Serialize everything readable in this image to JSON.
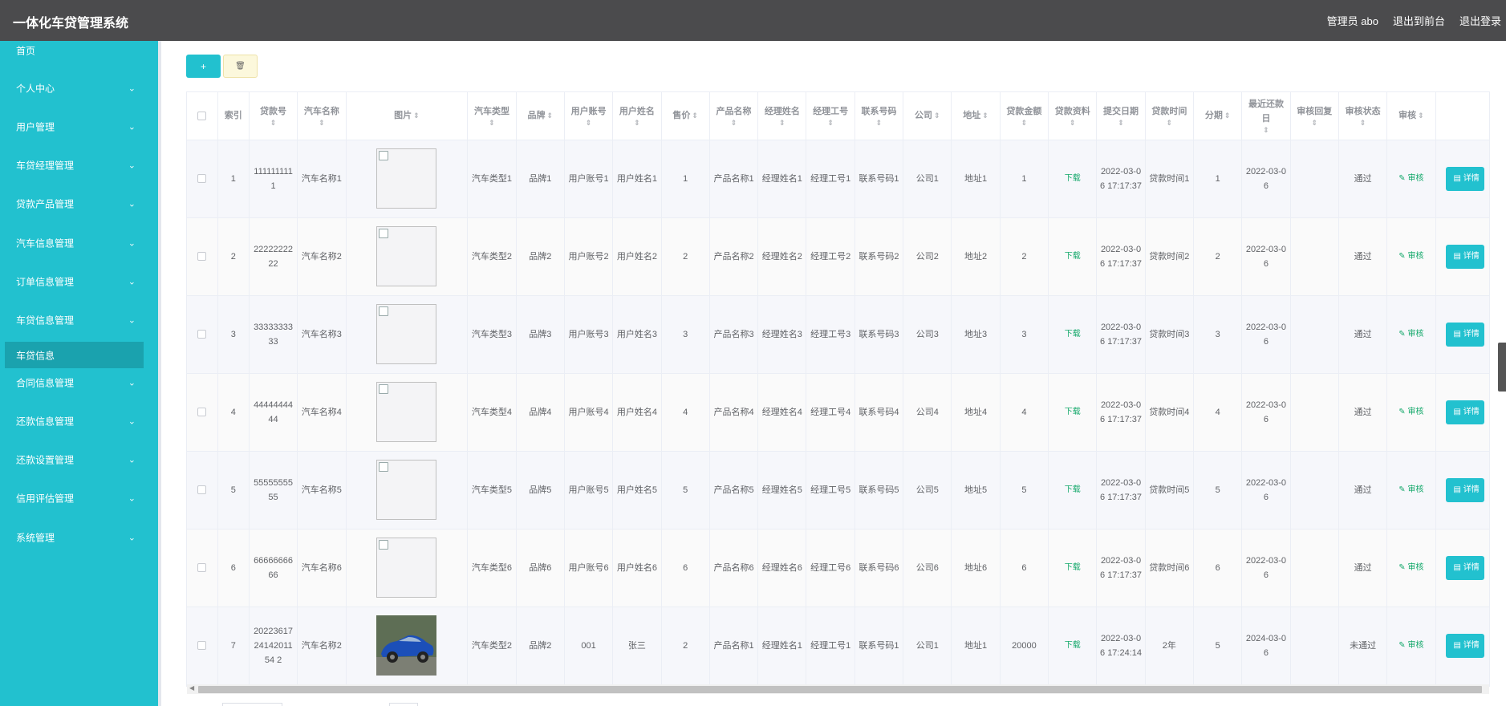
{
  "app": {
    "title": "一体化车贷管理系统",
    "admin_label": "管理员 abo",
    "to_frontend": "退出到前台",
    "logout": "退出登录"
  },
  "sidebar": {
    "items": [
      {
        "label": "首页",
        "chevron": false
      },
      {
        "label": "个人中心",
        "chevron": true
      },
      {
        "label": "用户管理",
        "chevron": true
      },
      {
        "label": "车贷经理管理",
        "chevron": true
      },
      {
        "label": "贷款产品管理",
        "chevron": true
      },
      {
        "label": "汽车信息管理",
        "chevron": true
      },
      {
        "label": "订单信息管理",
        "chevron": true
      },
      {
        "label": "车贷信息管理",
        "chevron": true
      },
      {
        "label": "合同信息管理",
        "chevron": true
      },
      {
        "label": "还款信息管理",
        "chevron": true
      },
      {
        "label": "还款设置管理",
        "chevron": true
      },
      {
        "label": "信用评估管理",
        "chevron": true
      },
      {
        "label": "系统管理",
        "chevron": true
      }
    ],
    "active_sub": "车贷信息"
  },
  "toolbar": {
    "add_icon": "plus-icon",
    "add_label": "+",
    "delete_icon": "trash-icon",
    "delete_label": "🗑"
  },
  "table": {
    "columns": [
      "索引",
      "贷款号",
      "汽车名称",
      "图片",
      "汽车类型",
      "品牌",
      "用户账号",
      "用户姓名",
      "售价",
      "产品名称",
      "经理姓名",
      "经理工号",
      "联系号码",
      "公司",
      "地址",
      "贷款金额",
      "贷款资料",
      "提交日期",
      "贷款时间",
      "分期",
      "最近还款日",
      "审核回复",
      "审核状态",
      "审核",
      ""
    ],
    "download_label": "下载",
    "review_label": "审核",
    "detail_label": "详情",
    "rows": [
      {
        "index": "1",
        "loan_no": "1111111111",
        "car_name": "汽车名称1",
        "image": "broken",
        "car_type": "汽车类型1",
        "brand": "品牌1",
        "user_account": "用户账号1",
        "user_name": "用户姓名1",
        "price": "1",
        "product": "产品名称1",
        "manager_name": "经理姓名1",
        "manager_id": "经理工号1",
        "phone": "联系号码1",
        "company": "公司1",
        "address": "地址1",
        "amount": "1",
        "submit_date": "2022-03-06 17:17:37",
        "loan_time": "贷款时间1",
        "installments": "1",
        "repay_date": "2022-03-06",
        "reply": "",
        "status": "通过"
      },
      {
        "index": "2",
        "loan_no": "2222222222",
        "car_name": "汽车名称2",
        "image": "broken",
        "car_type": "汽车类型2",
        "brand": "品牌2",
        "user_account": "用户账号2",
        "user_name": "用户姓名2",
        "price": "2",
        "product": "产品名称2",
        "manager_name": "经理姓名2",
        "manager_id": "经理工号2",
        "phone": "联系号码2",
        "company": "公司2",
        "address": "地址2",
        "amount": "2",
        "submit_date": "2022-03-06 17:17:37",
        "loan_time": "贷款时间2",
        "installments": "2",
        "repay_date": "2022-03-06",
        "reply": "",
        "status": "通过"
      },
      {
        "index": "3",
        "loan_no": "3333333333",
        "car_name": "汽车名称3",
        "image": "broken",
        "car_type": "汽车类型3",
        "brand": "品牌3",
        "user_account": "用户账号3",
        "user_name": "用户姓名3",
        "price": "3",
        "product": "产品名称3",
        "manager_name": "经理姓名3",
        "manager_id": "经理工号3",
        "phone": "联系号码3",
        "company": "公司3",
        "address": "地址3",
        "amount": "3",
        "submit_date": "2022-03-06 17:17:37",
        "loan_time": "贷款时间3",
        "installments": "3",
        "repay_date": "2022-03-06",
        "reply": "",
        "status": "通过"
      },
      {
        "index": "4",
        "loan_no": "4444444444",
        "car_name": "汽车名称4",
        "image": "broken",
        "car_type": "汽车类型4",
        "brand": "品牌4",
        "user_account": "用户账号4",
        "user_name": "用户姓名4",
        "price": "4",
        "product": "产品名称4",
        "manager_name": "经理姓名4",
        "manager_id": "经理工号4",
        "phone": "联系号码4",
        "company": "公司4",
        "address": "地址4",
        "amount": "4",
        "submit_date": "2022-03-06 17:17:37",
        "loan_time": "贷款时间4",
        "installments": "4",
        "repay_date": "2022-03-06",
        "reply": "",
        "status": "通过"
      },
      {
        "index": "5",
        "loan_no": "5555555555",
        "car_name": "汽车名称5",
        "image": "broken",
        "car_type": "汽车类型5",
        "brand": "品牌5",
        "user_account": "用户账号5",
        "user_name": "用户姓名5",
        "price": "5",
        "product": "产品名称5",
        "manager_name": "经理姓名5",
        "manager_id": "经理工号5",
        "phone": "联系号码5",
        "company": "公司5",
        "address": "地址5",
        "amount": "5",
        "submit_date": "2022-03-06 17:17:37",
        "loan_time": "贷款时间5",
        "installments": "5",
        "repay_date": "2022-03-06",
        "reply": "",
        "status": "通过"
      },
      {
        "index": "6",
        "loan_no": "6666666666",
        "car_name": "汽车名称6",
        "image": "broken",
        "car_type": "汽车类型6",
        "brand": "品牌6",
        "user_account": "用户账号6",
        "user_name": "用户姓名6",
        "price": "6",
        "product": "产品名称6",
        "manager_name": "经理姓名6",
        "manager_id": "经理工号6",
        "phone": "联系号码6",
        "company": "公司6",
        "address": "地址6",
        "amount": "6",
        "submit_date": "2022-03-06 17:17:37",
        "loan_time": "贷款时间6",
        "installments": "6",
        "repay_date": "2022-03-06",
        "reply": "",
        "status": "通过"
      },
      {
        "index": "7",
        "loan_no": "202236172414201154 2",
        "car_name": "汽车名称2",
        "image": "car",
        "car_type": "汽车类型2",
        "brand": "品牌2",
        "user_account": "001",
        "user_name": "张三",
        "price": "2",
        "product": "产品名称1",
        "manager_name": "经理姓名1",
        "manager_id": "经理工号1",
        "phone": "联系号码1",
        "company": "公司1",
        "address": "地址1",
        "amount": "20000",
        "submit_date": "2022-03-06 17:24:14",
        "loan_time": "2年",
        "installments": "5",
        "repay_date": "2024-03-06",
        "reply": "",
        "status": "未通过"
      }
    ]
  },
  "colors": {
    "topbar": "#4b4b4d",
    "sidebar": "#22c1cf",
    "sidebar_active": "#1aa2ae",
    "accent": "#22c1cf",
    "link_green": "#13a86a"
  }
}
